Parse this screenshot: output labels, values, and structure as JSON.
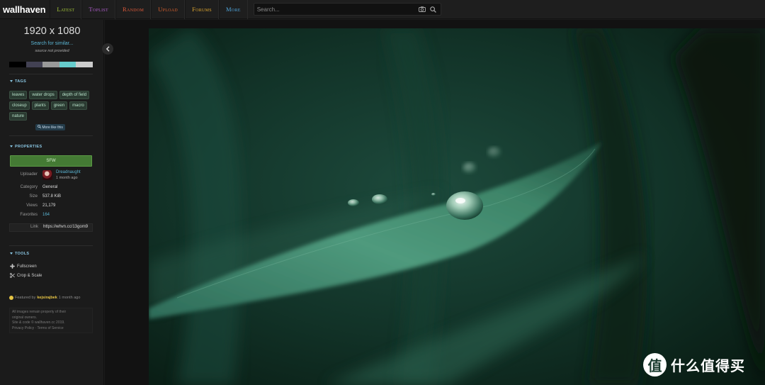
{
  "logo": "wallhaven",
  "nav": [
    {
      "label": "Latest",
      "color": "#a4c639"
    },
    {
      "label": "Toplist",
      "color": "#b35fd1"
    },
    {
      "label": "Random",
      "color": "#e05a3a"
    },
    {
      "label": "Upload",
      "color": "#d8612f"
    },
    {
      "label": "Forums",
      "color": "#e0a830"
    },
    {
      "label": "More",
      "color": "#4fa3d8"
    }
  ],
  "search": {
    "placeholder": "Search..."
  },
  "sidebar": {
    "resolution": "1920 x 1080",
    "similar_link": "Search for similar...",
    "source": "source not provided",
    "palette": [
      "#000000",
      "#424153",
      "#999999",
      "#66cccc",
      "#cccccc"
    ],
    "tags_title": "TAGS",
    "tags": [
      "leaves",
      "water drops",
      "depth of field",
      "closeup",
      "plants",
      "green",
      "macro",
      "nature"
    ],
    "more_like_this": "More like this",
    "properties_title": "PROPERTIES",
    "purity": "SFW",
    "properties": {
      "uploader_label": "Uploader",
      "uploader_name": "Dreadnaught",
      "uploader_time": "1 month ago",
      "category_label": "Category",
      "category": "General",
      "size_label": "Size",
      "size": "537.8 KiB",
      "views_label": "Views",
      "views": "21,179",
      "favorites_label": "Favorites",
      "favorites": "164",
      "link_label": "Link",
      "link": "https://whvn.cc/13gom9"
    },
    "tools_title": "TOOLS",
    "tools": [
      "Fullscreen",
      "Crop & Scale"
    ],
    "featured_prefix": "Featured by",
    "featured_by": "kejsirajbek",
    "featured_time": "1 month ago",
    "footer_lines": [
      "All images remain property of their",
      "original owners.",
      "Site & code © wallhaven.cc 2019.",
      "Privacy Policy · Terms of Service"
    ]
  },
  "watermark": {
    "symbol": "值",
    "text": "什么值得买"
  }
}
